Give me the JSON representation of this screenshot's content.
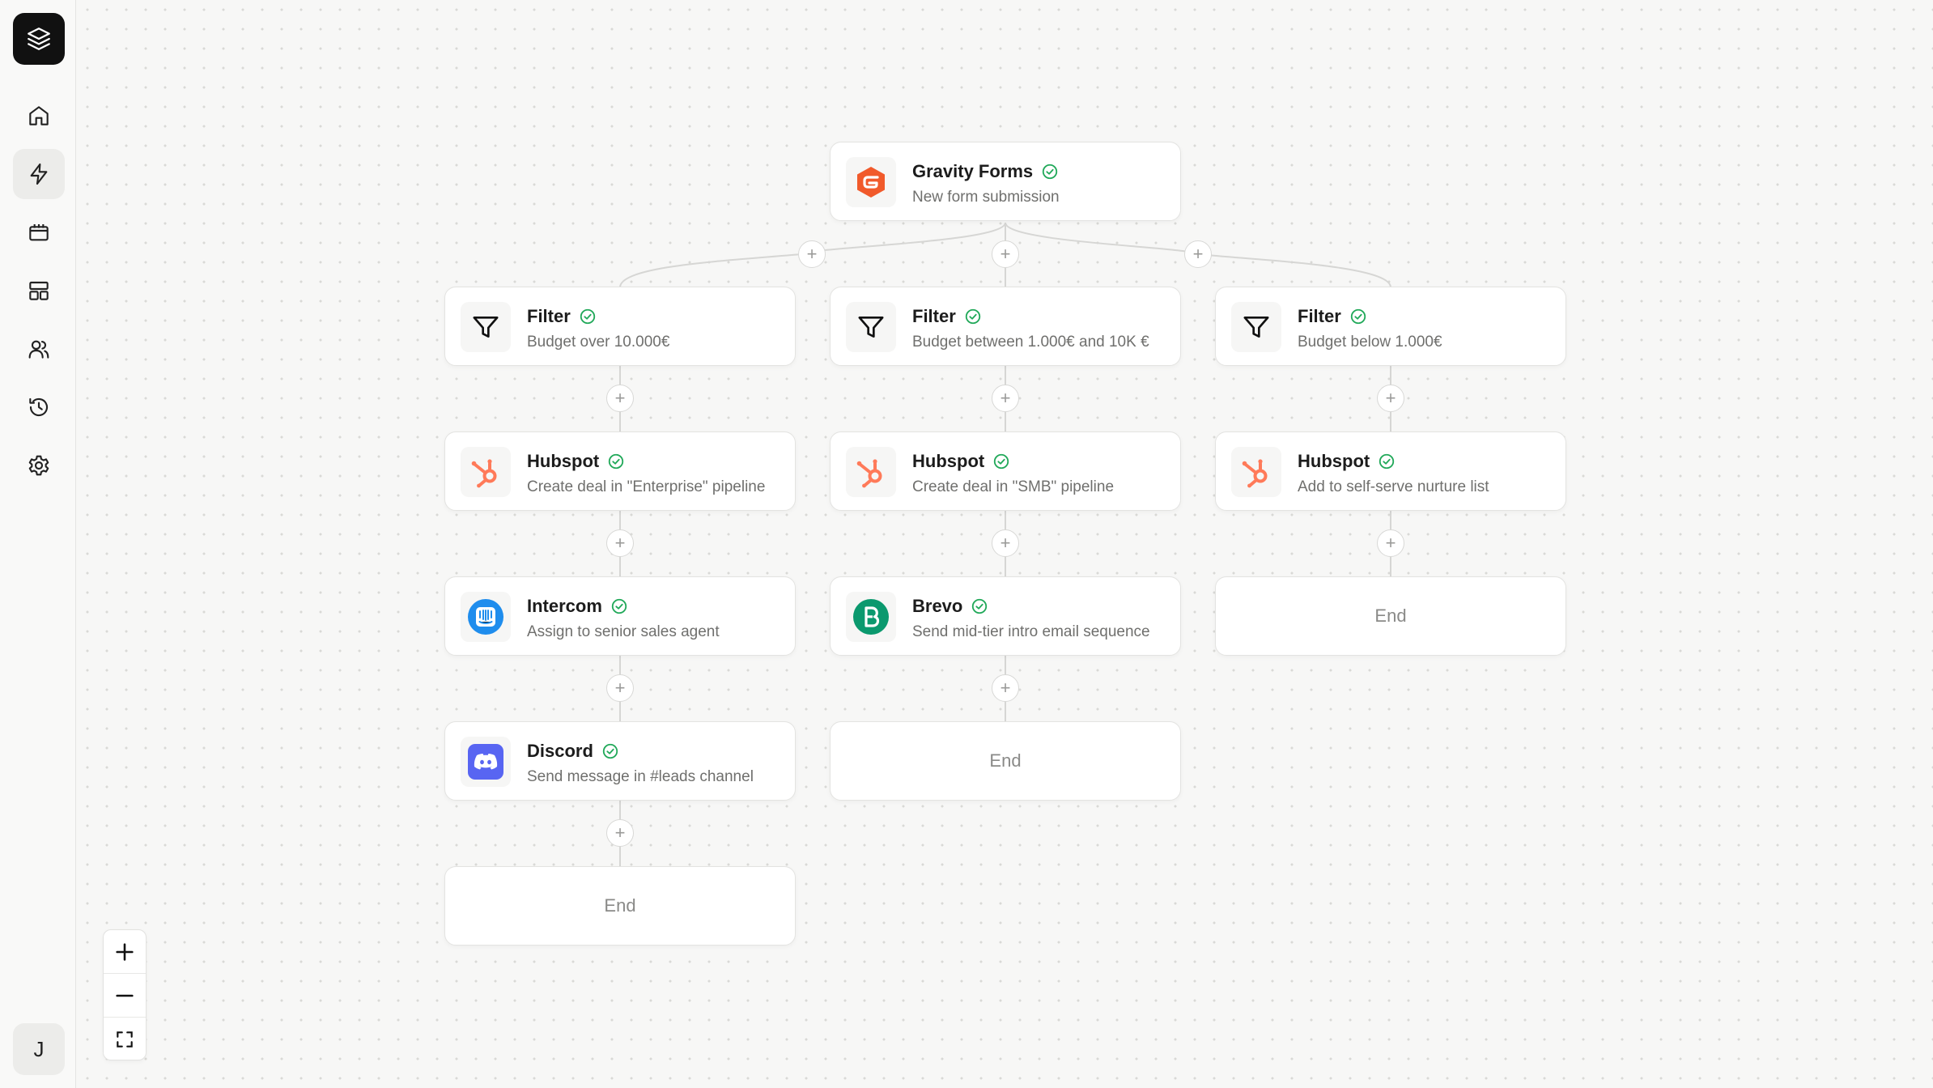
{
  "sidebar": {
    "logo": "layers-icon",
    "items": [
      {
        "name": "home",
        "icon": "home-icon"
      },
      {
        "name": "automations",
        "icon": "bolt-icon",
        "active": true
      },
      {
        "name": "calendar",
        "icon": "calendar-icon"
      },
      {
        "name": "templates",
        "icon": "layout-icon"
      },
      {
        "name": "users",
        "icon": "users-icon"
      },
      {
        "name": "history",
        "icon": "history-icon"
      },
      {
        "name": "settings",
        "icon": "gear-icon"
      }
    ],
    "avatar_initial": "J"
  },
  "zoom_controls": {
    "zoom_in": "+",
    "zoom_out": "−",
    "fit": "fit-screen-icon"
  },
  "colors": {
    "hubspot": "#ff7a59",
    "gravity": "#f15a2b",
    "intercom": "#1f8ded",
    "brevo": "#0b996e",
    "discord": "#5865f2",
    "check": "#22a95a"
  },
  "trigger": {
    "title": "Gravity Forms",
    "subtitle": "New form submission",
    "icon": "gravity-forms-icon"
  },
  "branches": [
    {
      "steps": [
        {
          "title": "Filter",
          "subtitle": "Budget over 10.000€",
          "icon": "filter-icon"
        },
        {
          "title": "Hubspot",
          "subtitle": "Create deal in \"Enterprise\" pipeline",
          "icon": "hubspot-icon"
        },
        {
          "title": "Intercom",
          "subtitle": "Assign to senior sales agent",
          "icon": "intercom-icon"
        },
        {
          "title": "Discord",
          "subtitle": "Send message in #leads channel",
          "icon": "discord-icon"
        }
      ],
      "end_label": "End"
    },
    {
      "steps": [
        {
          "title": "Filter",
          "subtitle": "Budget between 1.000€ and 10K €",
          "icon": "filter-icon"
        },
        {
          "title": "Hubspot",
          "subtitle": "Create deal in \"SMB\" pipeline",
          "icon": "hubspot-icon"
        },
        {
          "title": "Brevo",
          "subtitle": "Send mid-tier intro email sequence",
          "icon": "brevo-icon"
        }
      ],
      "end_label": "End"
    },
    {
      "steps": [
        {
          "title": "Filter",
          "subtitle": "Budget below 1.000€",
          "icon": "filter-icon"
        },
        {
          "title": "Hubspot",
          "subtitle": "Add to self-serve nurture list",
          "icon": "hubspot-icon"
        }
      ],
      "end_label": "End"
    }
  ],
  "add_step_label": "+"
}
